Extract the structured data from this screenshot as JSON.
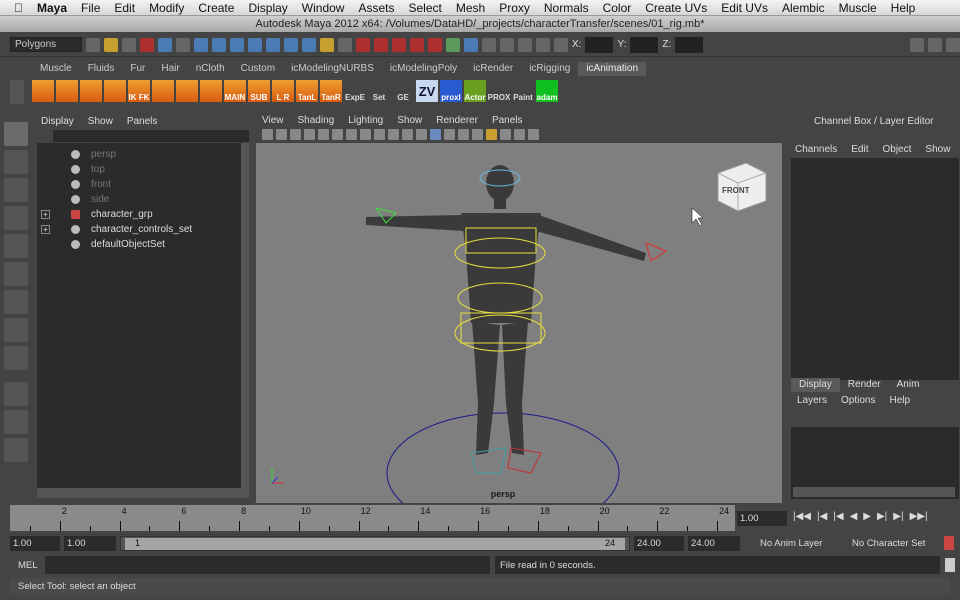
{
  "mac_menu": [
    "Maya",
    "File",
    "Edit",
    "Modify",
    "Create",
    "Display",
    "Window",
    "Assets",
    "Select",
    "Mesh",
    "Proxy",
    "Normals",
    "Color",
    "Create UVs",
    "Edit UVs",
    "Alembic",
    "Muscle",
    "Help"
  ],
  "window_title": "Autodesk Maya 2012 x64: /Volumes/DataHD/_projects/characterTransfer/scenes/01_rig.mb*",
  "status_line": {
    "menu_set": "Polygons",
    "x_label": "X:",
    "y_label": "Y:",
    "z_label": "Z:"
  },
  "shelf_tabs": [
    "Muscle",
    "Fluids",
    "Fur",
    "Hair",
    "nCloth",
    "Custom",
    "icModelingNURBS",
    "icModelingPoly",
    "icRender",
    "icRigging",
    "icAnimation"
  ],
  "active_shelf": "icAnimation",
  "shelf_buttons": [
    "",
    "",
    "",
    "",
    "IK FK",
    "",
    "",
    "",
    "MAIN",
    "SUB",
    "L R",
    "TanL",
    "TanR",
    "ExpE",
    "Set",
    "GE",
    "ZV",
    "proxl",
    "Actor",
    "PROX",
    "Paint",
    "adam"
  ],
  "outliner": {
    "menu": [
      "Display",
      "Show",
      "Panels"
    ],
    "items": [
      {
        "label": "persp",
        "dim": true
      },
      {
        "label": "top",
        "dim": true
      },
      {
        "label": "front",
        "dim": true
      },
      {
        "label": "side",
        "dim": true
      },
      {
        "label": "character_grp",
        "dim": false,
        "expand": "+"
      },
      {
        "label": "character_controls_set",
        "dim": false,
        "expand": "+"
      },
      {
        "label": "defaultObjectSet",
        "dim": false
      }
    ]
  },
  "viewport": {
    "menu": [
      "View",
      "Shading",
      "Lighting",
      "Show",
      "Renderer",
      "Panels"
    ],
    "camera_label": "persp",
    "viewcube_label": "FRONT"
  },
  "channel_box": {
    "title": "Channel Box / Layer Editor",
    "menu": [
      "Channels",
      "Edit",
      "Object",
      "Show"
    ],
    "layer_tabs": [
      "Display",
      "Render",
      "Anim"
    ],
    "layer_menu": [
      "Layers",
      "Options",
      "Help"
    ]
  },
  "timeline": {
    "ticks": [
      "2",
      "4",
      "6",
      "8",
      "10",
      "12",
      "14",
      "16",
      "18",
      "20",
      "22",
      "24"
    ],
    "current_frame": "1.00"
  },
  "range": {
    "start": "1.00",
    "inner_start": "1.00",
    "bar_start": "1",
    "bar_end": "24",
    "inner_end": "24.00",
    "end": "24.00",
    "anim_layer": "No Anim Layer",
    "char_set": "No Character Set"
  },
  "command_line": {
    "label": "MEL",
    "result": "File read in 0 seconds."
  },
  "help_line": "Select Tool: select an object"
}
